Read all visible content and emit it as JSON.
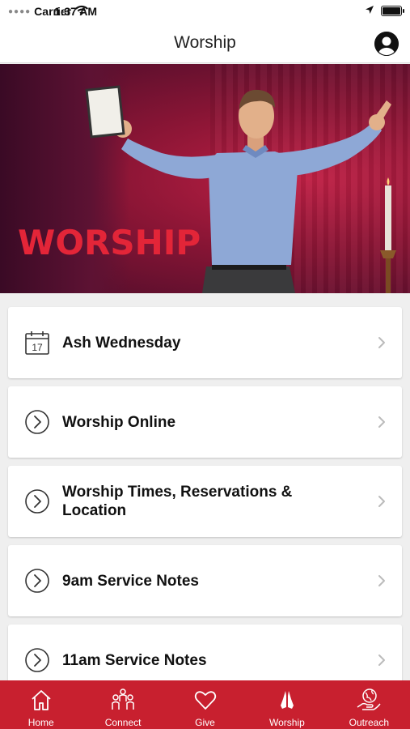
{
  "status_bar": {
    "carrier": "Carrier",
    "time": "1:37 AM"
  },
  "nav": {
    "title": "Worship"
  },
  "hero": {
    "headline": "WORSHIP"
  },
  "list": {
    "items": [
      {
        "label": "Ash Wednesday",
        "icon": "calendar-icon",
        "date_number": "17"
      },
      {
        "label": "Worship Online",
        "icon": "play-circle-icon"
      },
      {
        "label": "Worship Times, Reservations & Location",
        "icon": "play-circle-icon"
      },
      {
        "label": "9am Service Notes",
        "icon": "play-circle-icon"
      },
      {
        "label": "11am Service Notes",
        "icon": "play-circle-icon"
      }
    ]
  },
  "tabs": [
    {
      "label": "Home",
      "icon": "home-icon"
    },
    {
      "label": "Connect",
      "icon": "people-icon"
    },
    {
      "label": "Give",
      "icon": "heart-icon"
    },
    {
      "label": "Worship",
      "icon": "praying-hands-icon"
    },
    {
      "label": "Outreach",
      "icon": "globe-hand-icon"
    }
  ],
  "colors": {
    "tab_bar": "#c8202f",
    "hero_text": "#e32538"
  }
}
